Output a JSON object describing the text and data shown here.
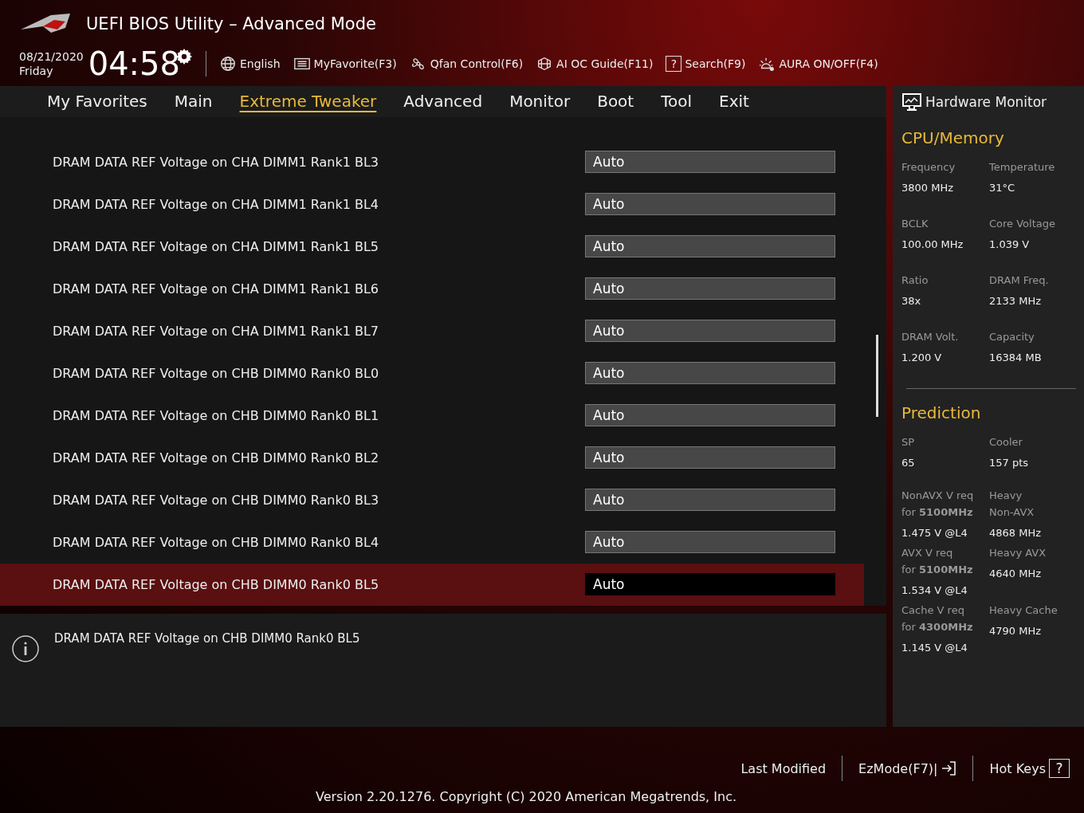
{
  "header": {
    "title": "UEFI BIOS Utility – Advanced Mode",
    "date": "08/21/2020",
    "day": "Friday",
    "time": "04:58",
    "tools": [
      {
        "kind": "language",
        "label": "English"
      },
      {
        "kind": "favorite",
        "label": "MyFavorite(F3)"
      },
      {
        "kind": "fan",
        "label": "Qfan Control(F6)"
      },
      {
        "kind": "guide",
        "label": "AI OC Guide(F11)"
      },
      {
        "kind": "search",
        "label": "Search(F9)",
        "glyph": "?"
      },
      {
        "kind": "aura",
        "label": "AURA ON/OFF(F4)"
      }
    ]
  },
  "tabs": [
    {
      "label": "My Favorites",
      "selected": false
    },
    {
      "label": "Main",
      "selected": false
    },
    {
      "label": "Extreme Tweaker",
      "selected": true
    },
    {
      "label": "Advanced",
      "selected": false
    },
    {
      "label": "Monitor",
      "selected": false
    },
    {
      "label": "Boot",
      "selected": false
    },
    {
      "label": "Tool",
      "selected": false
    },
    {
      "label": "Exit",
      "selected": false
    }
  ],
  "settings": [
    {
      "label": "DRAM DATA REF Voltage on CHA DIMM1 Rank1 BL3",
      "value": "Auto",
      "selected": false
    },
    {
      "label": "DRAM DATA REF Voltage on CHA DIMM1 Rank1 BL4",
      "value": "Auto",
      "selected": false
    },
    {
      "label": "DRAM DATA REF Voltage on CHA DIMM1 Rank1 BL5",
      "value": "Auto",
      "selected": false
    },
    {
      "label": "DRAM DATA REF Voltage on CHA DIMM1 Rank1 BL6",
      "value": "Auto",
      "selected": false
    },
    {
      "label": "DRAM DATA REF Voltage on CHA DIMM1 Rank1 BL7",
      "value": "Auto",
      "selected": false
    },
    {
      "label": "DRAM DATA REF Voltage on CHB DIMM0 Rank0 BL0",
      "value": "Auto",
      "selected": false
    },
    {
      "label": "DRAM DATA REF Voltage on CHB DIMM0 Rank0 BL1",
      "value": "Auto",
      "selected": false
    },
    {
      "label": "DRAM DATA REF Voltage on CHB DIMM0 Rank0 BL2",
      "value": "Auto",
      "selected": false
    },
    {
      "label": "DRAM DATA REF Voltage on CHB DIMM0 Rank0 BL3",
      "value": "Auto",
      "selected": false
    },
    {
      "label": "DRAM DATA REF Voltage on CHB DIMM0 Rank0 BL4",
      "value": "Auto",
      "selected": false
    },
    {
      "label": "DRAM DATA REF Voltage on CHB DIMM0 Rank0 BL5",
      "value": "Auto",
      "selected": true
    }
  ],
  "help_text": "DRAM DATA REF Voltage on CHB DIMM0 Rank0 BL5",
  "hardware_monitor": {
    "title": "Hardware Monitor",
    "sections": [
      {
        "title": "CPU/Memory",
        "items": [
          {
            "label": [
              "Frequency"
            ],
            "value": "3800 MHz"
          },
          {
            "label": [
              "Temperature"
            ],
            "value": "31°C"
          },
          {
            "label": [
              "BCLK"
            ],
            "value": "100.00 MHz"
          },
          {
            "label": [
              "Core Voltage"
            ],
            "value": "1.039 V"
          },
          {
            "label": [
              "Ratio"
            ],
            "value": "38x"
          },
          {
            "label": [
              "DRAM Freq."
            ],
            "value": "2133 MHz"
          },
          {
            "label": [
              "DRAM Volt."
            ],
            "value": "1.200 V"
          },
          {
            "label": [
              "Capacity"
            ],
            "value": "16384 MB"
          }
        ]
      },
      {
        "title": "Prediction",
        "items": [
          {
            "label": [
              "SP"
            ],
            "value": "65"
          },
          {
            "label": [
              "Cooler"
            ],
            "value": "157 pts"
          },
          {
            "label": [
              "NonAVX V req",
              "for **5100MHz**"
            ],
            "value": "1.475 V @L4"
          },
          {
            "label": [
              "Heavy",
              "Non-AVX"
            ],
            "value": "4868 MHz"
          },
          {
            "label": [
              "AVX V req",
              "for **5100MHz**"
            ],
            "value": "1.534 V @L4"
          },
          {
            "label": [
              "Heavy AVX"
            ],
            "value": "4640 MHz"
          },
          {
            "label": [
              "Cache V req",
              "for **4300MHz**"
            ],
            "value": "1.145 V @L4"
          },
          {
            "label": [
              "Heavy Cache"
            ],
            "value": "4790 MHz"
          }
        ]
      }
    ]
  },
  "footer": {
    "last_modified": "Last Modified",
    "ez_mode": "EzMode(F7)|",
    "hot_keys": "Hot Keys",
    "hot_keys_glyph": "?",
    "version": "Version 2.20.1276. Copyright (C) 2020 American Megatrends, Inc."
  }
}
